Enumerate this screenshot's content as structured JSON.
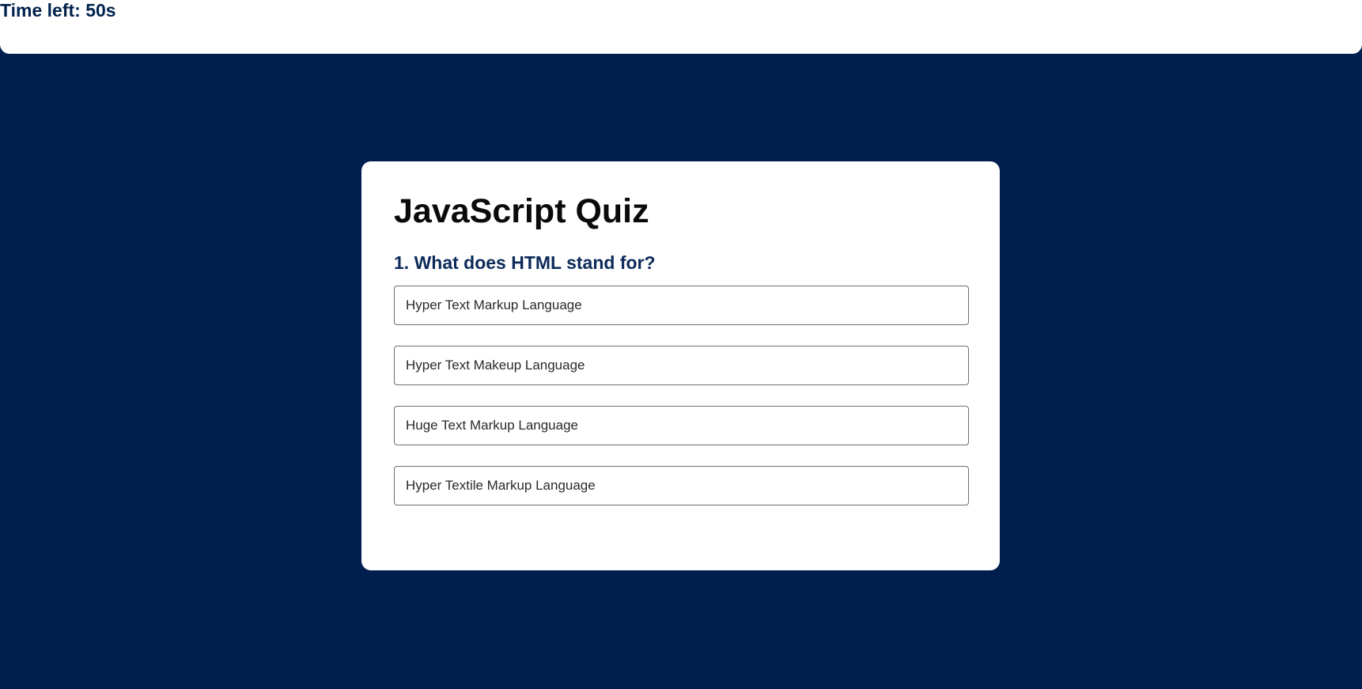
{
  "timer": {
    "label": "Time left: 50s"
  },
  "quiz": {
    "title": "JavaScript Quiz",
    "question": "1. What does HTML stand for?",
    "options": [
      "Hyper Text Markup Language",
      "Hyper Text Makeup Language",
      "Huge Text Markup Language",
      "Hyper Textile Markup Language"
    ]
  },
  "colors": {
    "background": "#001f4f",
    "card": "#ffffff",
    "timer_text": "#00224d",
    "question_text": "#0c2a5a"
  }
}
